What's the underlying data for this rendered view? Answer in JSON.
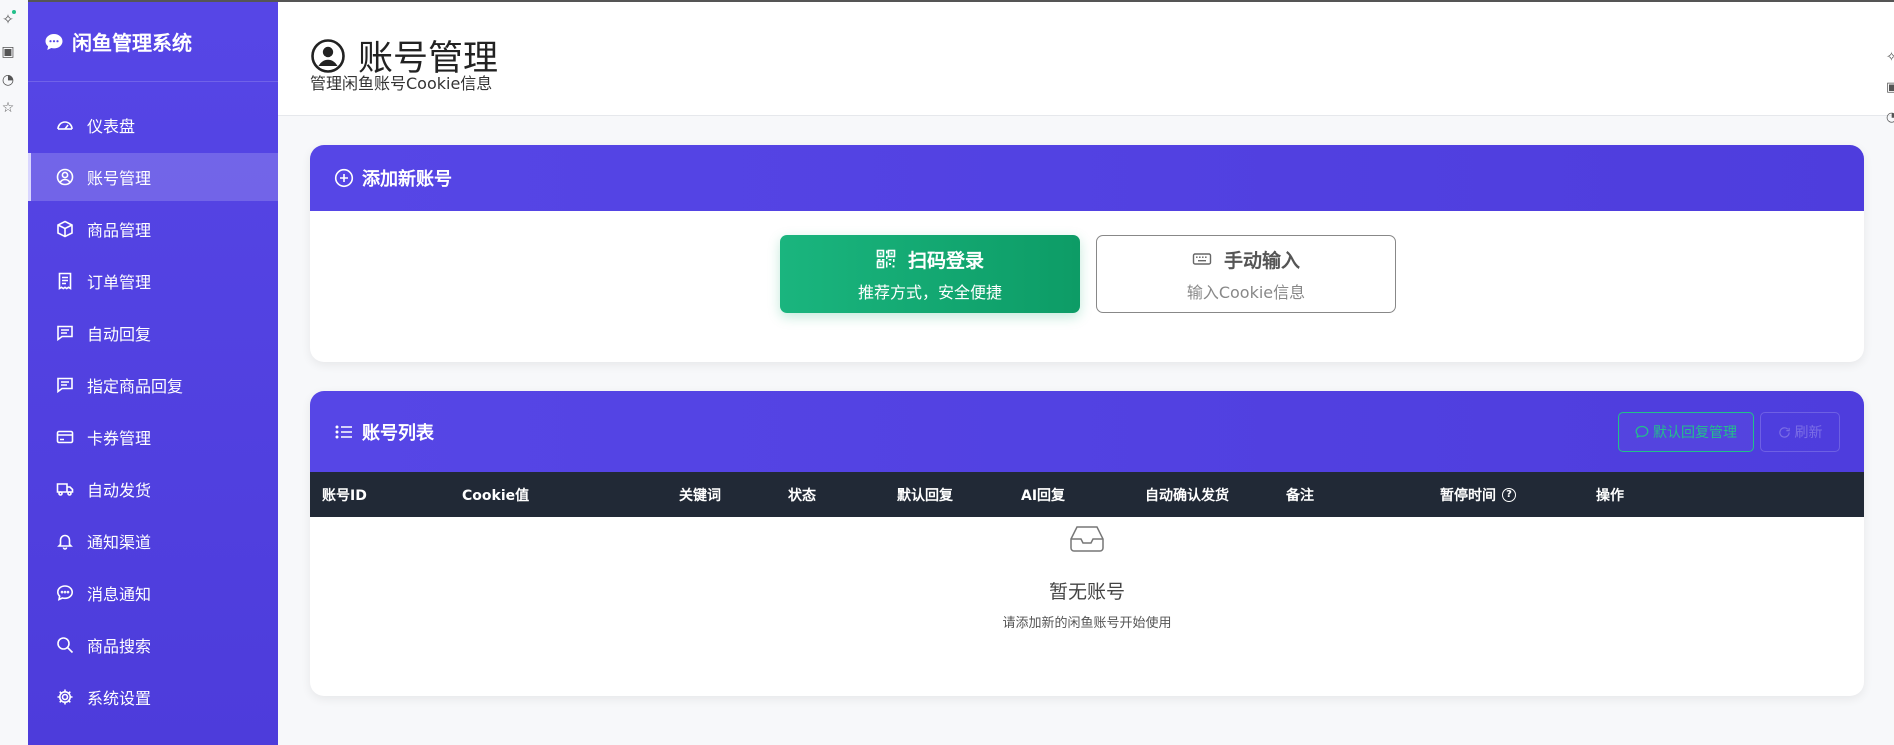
{
  "app": {
    "title": "闲鱼管理系统"
  },
  "sidebar": {
    "items": [
      {
        "label": "仪表盘",
        "icon": "dashboard-icon"
      },
      {
        "label": "账号管理",
        "icon": "user-circle-icon",
        "active": true
      },
      {
        "label": "商品管理",
        "icon": "box-icon"
      },
      {
        "label": "订单管理",
        "icon": "receipt-icon"
      },
      {
        "label": "自动回复",
        "icon": "chat-square-icon"
      },
      {
        "label": "指定商品回复",
        "icon": "chat-square-text-icon"
      },
      {
        "label": "卡券管理",
        "icon": "credit-card-icon"
      },
      {
        "label": "自动发货",
        "icon": "truck-icon"
      },
      {
        "label": "通知渠道",
        "icon": "bell-icon"
      },
      {
        "label": "消息通知",
        "icon": "chat-dots-icon"
      },
      {
        "label": "商品搜索",
        "icon": "search-icon"
      },
      {
        "label": "系统设置",
        "icon": "gear-icon"
      }
    ]
  },
  "header": {
    "title": "账号管理",
    "subtitle": "管理闲鱼账号Cookie信息"
  },
  "add_card": {
    "title": "添加新账号",
    "qr_button": {
      "title": "扫码登录",
      "sub": "推荐方式，安全便捷"
    },
    "manual_button": {
      "title": "手动输入",
      "sub": "输入Cookie信息"
    }
  },
  "list_card": {
    "title": "账号列表",
    "default_reply_label": "默认回复管理",
    "refresh_label": "刷新",
    "columns": [
      "账号ID",
      "Cookie值",
      "关键词",
      "状态",
      "默认回复",
      "AI回复",
      "自动确认发货",
      "备注",
      "暂停时间",
      "操作"
    ],
    "empty_title": "暂无账号",
    "empty_sub": "请添加新的闲鱼账号开始使用"
  },
  "colors": {
    "sidebar": "#5646e6",
    "accent_green": "#22c08a",
    "table_head": "#212936"
  }
}
